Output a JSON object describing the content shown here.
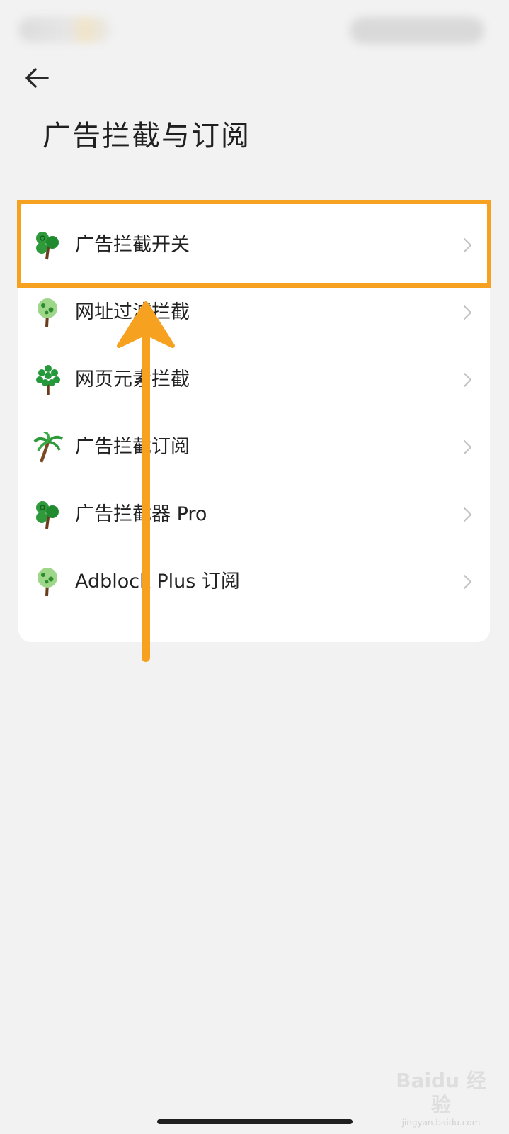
{
  "header": {
    "title": "广告拦截与订阅",
    "back_icon": "arrow-left-icon"
  },
  "menu": {
    "items": [
      {
        "label": "广告拦截开关",
        "icon": "tree-icon",
        "highlighted": true
      },
      {
        "label": "网址过滤拦截",
        "icon": "tree-icon"
      },
      {
        "label": "网页元素拦截",
        "icon": "tree-icon"
      },
      {
        "label": "广告拦截订阅",
        "icon": "palm-tree-icon"
      },
      {
        "label": "广告拦截器 Pro",
        "icon": "tree-icon"
      },
      {
        "label": "Adblock Plus 订阅",
        "icon": "tree-icon"
      }
    ]
  },
  "annotation": {
    "color": "#f6a11f"
  },
  "watermark": {
    "brand": "Baidu 经验",
    "url": "jingyan.baidu.com"
  }
}
